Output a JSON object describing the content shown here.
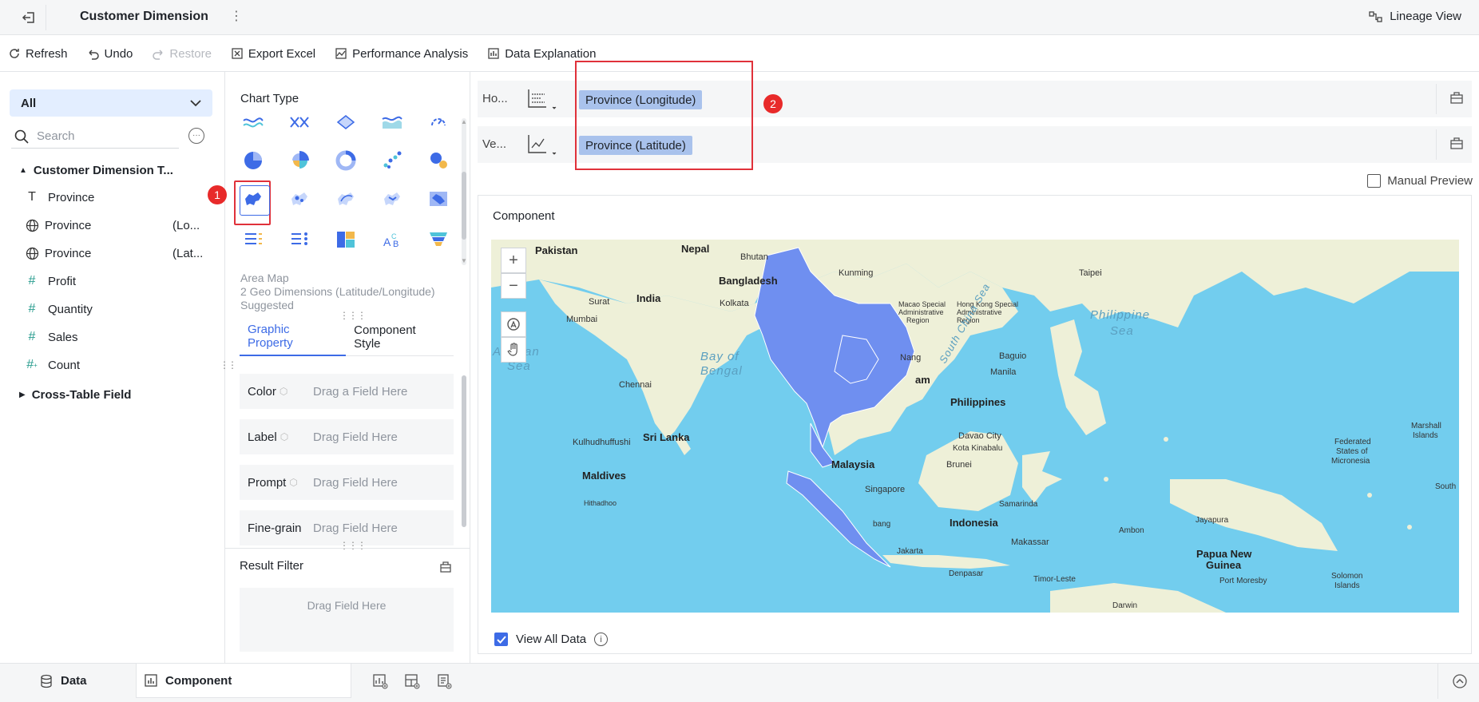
{
  "header": {
    "title": "Customer Dimension",
    "lineage_label": "Lineage View"
  },
  "toolbar": {
    "refresh": "Refresh",
    "undo": "Undo",
    "restore": "Restore",
    "export_excel": "Export Excel",
    "performance_analysis": "Performance Analysis",
    "data_explanation": "Data Explanation"
  },
  "left": {
    "dropdown_value": "All",
    "search_placeholder": "Search",
    "group_title": "Customer Dimension T...",
    "fields": [
      {
        "icon": "text-icon",
        "label": "Province",
        "suffix": ""
      },
      {
        "icon": "globe-icon",
        "label": "Province",
        "suffix": "(Lo..."
      },
      {
        "icon": "globe-icon",
        "label": "Province",
        "suffix": "(Lat..."
      },
      {
        "icon": "hash-icon",
        "label": "Profit",
        "suffix": ""
      },
      {
        "icon": "hash-icon",
        "label": "Quantity",
        "suffix": ""
      },
      {
        "icon": "hash-icon",
        "label": "Sales",
        "suffix": ""
      },
      {
        "icon": "count-icon",
        "label": "Count",
        "suffix": ""
      }
    ],
    "cross_table": "Cross-Table Field"
  },
  "middle": {
    "chart_type_label": "Chart Type",
    "badge1": "1",
    "area_info": [
      "Area Map",
      "2 Geo Dimensions (Latitude/Longitude)",
      "Suggested"
    ],
    "tabs": [
      "Graphic Property",
      "Component Style"
    ],
    "props": [
      {
        "label": "Color",
        "drop": "Drag a Field Here"
      },
      {
        "label": "Label",
        "drop": "Drag Field Here"
      },
      {
        "label": "Prompt",
        "drop": "Drag Field Here"
      },
      {
        "label": "Fine-grain",
        "drop": "Drag Field Here"
      }
    ],
    "result_filter": "Result Filter",
    "result_filter_drop": "Drag Field Here"
  },
  "right": {
    "horizontal_label": "Ho...",
    "vertical_label": "Ve...",
    "horizontal_pill": "Province (Longitude)",
    "vertical_pill": "Province (Latitude)",
    "badge2": "2",
    "manual_preview": "Manual Preview",
    "component_label": "Component",
    "view_all": "View All Data"
  },
  "map": {
    "zoom_in": "+",
    "zoom_out": "−",
    "labels": [
      {
        "t": "Pakistan",
        "c": "b"
      },
      {
        "t": "Nepal",
        "c": "b"
      },
      {
        "t": "Bhutan",
        "c": ""
      },
      {
        "t": "Bangladesh",
        "c": "b"
      },
      {
        "t": "Kunming",
        "c": ""
      },
      {
        "t": "Taipei",
        "c": ""
      },
      {
        "t": "India",
        "c": "b"
      },
      {
        "t": "Surat",
        "c": ""
      },
      {
        "t": "Kolkata",
        "c": ""
      },
      {
        "t": "Mumbai",
        "c": ""
      },
      {
        "t": "Macao Special",
        "c": ""
      },
      {
        "t": "Administrative",
        "c": ""
      },
      {
        "t": "Region",
        "c": ""
      },
      {
        "t": "Hong Kong Special",
        "c": ""
      },
      {
        "t": "Administrative",
        "c": ""
      },
      {
        "t": "Region",
        "c": ""
      },
      {
        "t": "Philippine",
        "c": "sea"
      },
      {
        "t": "Sea",
        "c": "sea"
      },
      {
        "t": "Arabian",
        "c": "sea"
      },
      {
        "t": "Sea",
        "c": "sea"
      },
      {
        "t": "Bay of",
        "c": "sea"
      },
      {
        "t": "Bengal",
        "c": "sea"
      },
      {
        "t": "Chennai",
        "c": ""
      },
      {
        "t": "Nang",
        "c": ""
      },
      {
        "t": "am",
        "c": "b"
      },
      {
        "t": "Baguio",
        "c": ""
      },
      {
        "t": "Manila",
        "c": ""
      },
      {
        "t": "Philippines",
        "c": "b"
      },
      {
        "t": "South China Sea",
        "c": "sea"
      },
      {
        "t": "Kulhudhuffushi",
        "c": ""
      },
      {
        "t": "Sri Lanka",
        "c": "b"
      },
      {
        "t": "Davao City",
        "c": ""
      },
      {
        "t": "Kota Kinabalu",
        "c": ""
      },
      {
        "t": "Malaysia",
        "c": "b"
      },
      {
        "t": "Brunei",
        "c": ""
      },
      {
        "t": "Marshall",
        "c": ""
      },
      {
        "t": "Islands",
        "c": ""
      },
      {
        "t": "Federated",
        "c": ""
      },
      {
        "t": "States of",
        "c": ""
      },
      {
        "t": "Micronesia",
        "c": ""
      },
      {
        "t": "Maldives",
        "c": "b"
      },
      {
        "t": "Singapore",
        "c": ""
      },
      {
        "t": "Hithadhoo",
        "c": ""
      },
      {
        "t": "Samarinda",
        "c": ""
      },
      {
        "t": "Jayapura",
        "c": ""
      },
      {
        "t": "Indonesia",
        "c": "b"
      },
      {
        "t": "Ambon",
        "c": ""
      },
      {
        "t": "South",
        "c": ""
      },
      {
        "t": "Makassar",
        "c": ""
      },
      {
        "t": "Papua New",
        "c": "b"
      },
      {
        "t": "Guinea",
        "c": "b"
      },
      {
        "t": "Jakarta",
        "c": ""
      },
      {
        "t": "Denpasar",
        "c": ""
      },
      {
        "t": "Timor-Leste",
        "c": ""
      },
      {
        "t": "Port Moresby",
        "c": ""
      },
      {
        "t": "Solomon",
        "c": ""
      },
      {
        "t": "Islands",
        "c": ""
      },
      {
        "t": "Darwin",
        "c": ""
      },
      {
        "t": "bang",
        "c": ""
      }
    ]
  },
  "bottom": {
    "data_tab": "Data",
    "component_tab": "Component"
  },
  "colors": {
    "accent": "#3d6be6",
    "highlight": "#e0313a",
    "pill": "#a9c2ec",
    "sea": "#72cdee",
    "land": "#eef0d8",
    "region": "#6f8ff0"
  }
}
